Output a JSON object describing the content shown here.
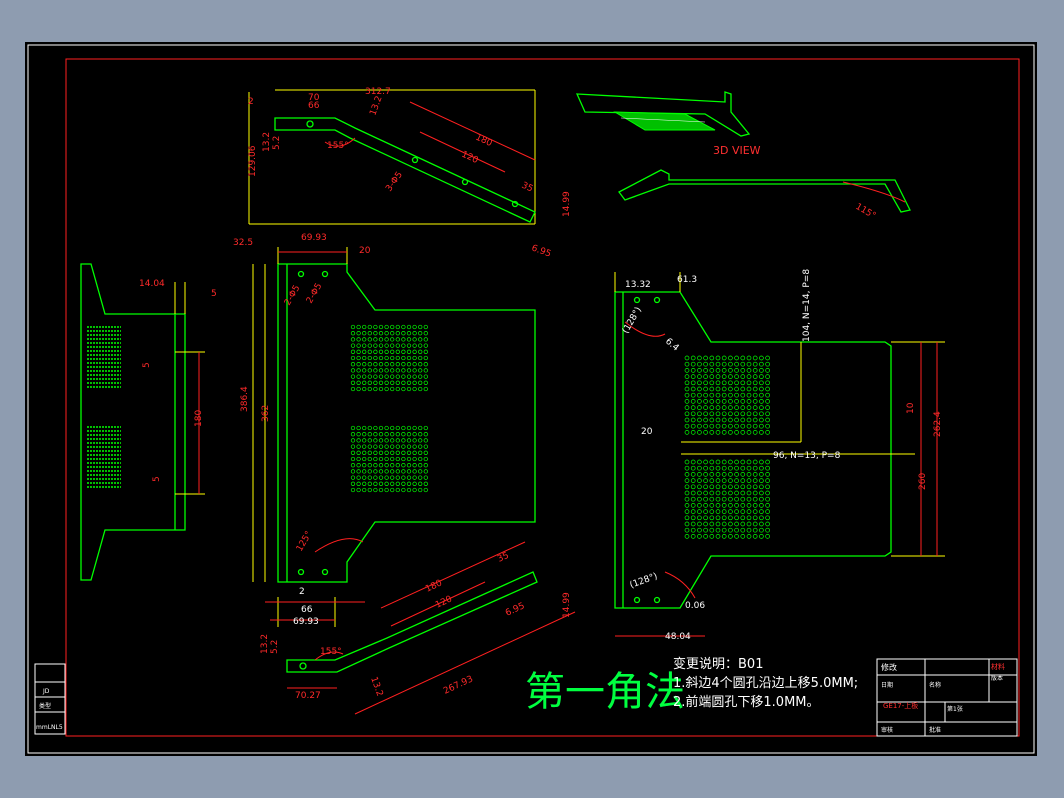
{
  "sheet": {
    "method_label": "第一角法",
    "change_title": "变更说明：B01",
    "change_line1": "1.斜边4个圆孔沿边上移5.0MM;",
    "change_line2": "2.前端圆孔下移1.0MM。"
  },
  "views": {
    "view3d_label": "3D VIEW",
    "top_view": {
      "dims": [
        "312.7",
        "70",
        "66",
        "2",
        "13.2",
        "13.2",
        "5.2",
        "129.06",
        "155°",
        "3-Φ5",
        "180",
        "120",
        "35",
        "14.99",
        "6.95"
      ]
    },
    "front_view": {
      "dims": [
        "32.5",
        "69.93",
        "20",
        "2-Φ5",
        "2-Φ5",
        "386.4",
        "362",
        "125°",
        "2",
        "66",
        "69.93"
      ]
    },
    "left_view": {
      "dims": [
        "14.04",
        "5",
        "5",
        "180",
        "5"
      ]
    },
    "bottom_view": {
      "dims": [
        "180",
        "120",
        "35",
        "6.95",
        "14.99",
        "13.2",
        "5.2",
        "155°",
        "70.27",
        "267.93",
        "13.2"
      ]
    },
    "right_view": {
      "dims": [
        "13.32",
        "61.3",
        "(128°)",
        "6.4",
        "104, N=14, P=8",
        "20",
        "96, N=13, P=8",
        "10",
        "262.4",
        "260",
        "(128°)",
        "0.06",
        "48.04"
      ],
      "bend_angle": "115°"
    }
  },
  "title_block": {
    "header": "修改",
    "part_no": "GE17-上板",
    "sheet_info": "第1张",
    "small_texts": [
      "材料",
      "版本",
      "日期",
      "名称",
      "审核",
      "批准"
    ]
  },
  "left_strip": {
    "texts": [
      "JD",
      "类型",
      "mmLNL5"
    ]
  },
  "colors": {
    "background": "#000000",
    "outline": "#00ff00",
    "dimension": "#ff2020",
    "extension": "#ffff00",
    "text": "#ffffff",
    "frame": "#ff2020",
    "outer_frame_bg": "#8e9cb0"
  }
}
